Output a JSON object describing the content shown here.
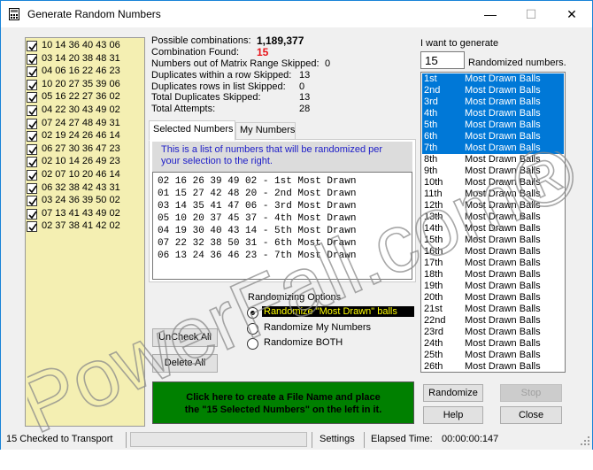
{
  "window": {
    "title": "Generate Random Numbers",
    "minimize_glyph": "—",
    "maximize_glyph": "☐",
    "close_glyph": "✕",
    "icon": "calculator-icon"
  },
  "tickets": [
    "10 14 36 40 43 06",
    "03 14 20 38 48 31",
    "04 06 16 22 46 23",
    "10 20 27 35 39 06",
    "05 16 22 27 36 02",
    "04 22 30 43 49 02",
    "07 24 27 48 49 31",
    "02 19 24 26 46 14",
    "06 27 30 36 47 23",
    "02 10 14 26 49 23",
    "02 07 10 20 46 14",
    "06 32 38 42 43 31",
    "03 24 36 39 50 02",
    "07 13 41 43 49 02",
    "02 37 38 41 42 02"
  ],
  "stats": {
    "possible_label": "Possible combinations:",
    "possible_value": "1,189,377",
    "found_label": "Combination Found:",
    "found_value": "15",
    "out_of_range_label": "Numbers out of Matrix Range Skipped:",
    "out_of_range_value": "0",
    "dup_row_label": "Duplicates within a row Skipped:",
    "dup_row_value": "13",
    "dup_list_label": "Duplicates rows in list Skipped:",
    "dup_list_value": "0",
    "total_dup_label": "Total Duplicates Skipped:",
    "total_dup_value": "13",
    "attempts_label": "Total Attempts:",
    "attempts_value": "28",
    "found_color": "#e8141a"
  },
  "tabs": [
    {
      "label": "Selected Numbers",
      "active": true
    },
    {
      "label": "My Numbers",
      "active": false
    }
  ],
  "info": {
    "line1": "This is a list of numbers that will be randomized per",
    "line2": "your selection to the right."
  },
  "draw_lines": [
    "02 16 26 39 49 02 - 1st Most Drawn",
    "01 15 27 42 48 20 - 2nd Most Drawn",
    "03 14 35 41 47 06 - 3rd Most Drawn",
    "05 10 20 37 45 37 - 4th Most Drawn",
    "04 19 30 40 43 14 - 5th Most Drawn",
    "07 22 32 38 50 31 - 6th Most Drawn",
    "06 13 24 36 46 23 - 7th Most Drawn"
  ],
  "options": {
    "title": "Randomizing Options",
    "items": [
      {
        "label": "Randomize \"Most Drawn\" balls",
        "selected": true
      },
      {
        "label": "Randomize My Numbers",
        "selected": false
      },
      {
        "label": "Randomize BOTH",
        "selected": false
      }
    ]
  },
  "buttons": {
    "uncheck_all": "UnCheck All",
    "delete_all": "Delete All",
    "create_file_line1": "Click here to create a File Name and place",
    "create_file_line2": "the \"15 Selected Numbers\" on the left in it.",
    "randomize": "Randomize",
    "stop": "Stop",
    "help": "Help",
    "close": "Close"
  },
  "generator": {
    "want_label": "I want to generate",
    "count_value": "15",
    "randomized_label": "Randomized numbers.",
    "rows": [
      {
        "rank": "1st",
        "desc": "Most Drawn Balls",
        "selected": true
      },
      {
        "rank": "2nd",
        "desc": "Most Drawn Balls",
        "selected": true
      },
      {
        "rank": "3rd",
        "desc": "Most Drawn Balls",
        "selected": true
      },
      {
        "rank": "4th",
        "desc": "Most Drawn Balls",
        "selected": true
      },
      {
        "rank": "5th",
        "desc": "Most Drawn Balls",
        "selected": true
      },
      {
        "rank": "6th",
        "desc": "Most Drawn Balls",
        "selected": true
      },
      {
        "rank": "7th",
        "desc": "Most Drawn Balls",
        "selected": true
      },
      {
        "rank": "8th",
        "desc": "Most Drawn Balls",
        "selected": false
      },
      {
        "rank": "9th",
        "desc": "Most Drawn Balls",
        "selected": false
      },
      {
        "rank": "10th",
        "desc": "Most Drawn Balls",
        "selected": false
      },
      {
        "rank": "11th",
        "desc": "Most Drawn Balls",
        "selected": false
      },
      {
        "rank": "12th",
        "desc": "Most Drawn Balls",
        "selected": false
      },
      {
        "rank": "13th",
        "desc": "Most Drawn Balls",
        "selected": false
      },
      {
        "rank": "14th",
        "desc": "Most Drawn Balls",
        "selected": false
      },
      {
        "rank": "15th",
        "desc": "Most Drawn Balls",
        "selected": false
      },
      {
        "rank": "16th",
        "desc": "Most Drawn Balls",
        "selected": false
      },
      {
        "rank": "17th",
        "desc": "Most Drawn Balls",
        "selected": false
      },
      {
        "rank": "18th",
        "desc": "Most Drawn Balls",
        "selected": false
      },
      {
        "rank": "19th",
        "desc": "Most Drawn Balls",
        "selected": false
      },
      {
        "rank": "20th",
        "desc": "Most Drawn Balls",
        "selected": false
      },
      {
        "rank": "21st",
        "desc": "Most Drawn Balls",
        "selected": false
      },
      {
        "rank": "22nd",
        "desc": "Most Drawn Balls",
        "selected": false
      },
      {
        "rank": "23rd",
        "desc": "Most Drawn Balls",
        "selected": false
      },
      {
        "rank": "24th",
        "desc": "Most Drawn Balls",
        "selected": false
      },
      {
        "rank": "25th",
        "desc": "Most Drawn Balls",
        "selected": false
      },
      {
        "rank": "26th",
        "desc": "Most Drawn Balls",
        "selected": false
      }
    ]
  },
  "status": {
    "checked": "15 Checked to Transport",
    "settings": "Settings",
    "elapsed_label": "Elapsed Time:",
    "elapsed_value": "00:00:00:147"
  },
  "watermark": "PowerFall.com®",
  "colors": {
    "ticket_bg": "#f4efb2",
    "selection": "#0078d7",
    "green_button": "#008000",
    "info_text": "#1c1cc8"
  }
}
